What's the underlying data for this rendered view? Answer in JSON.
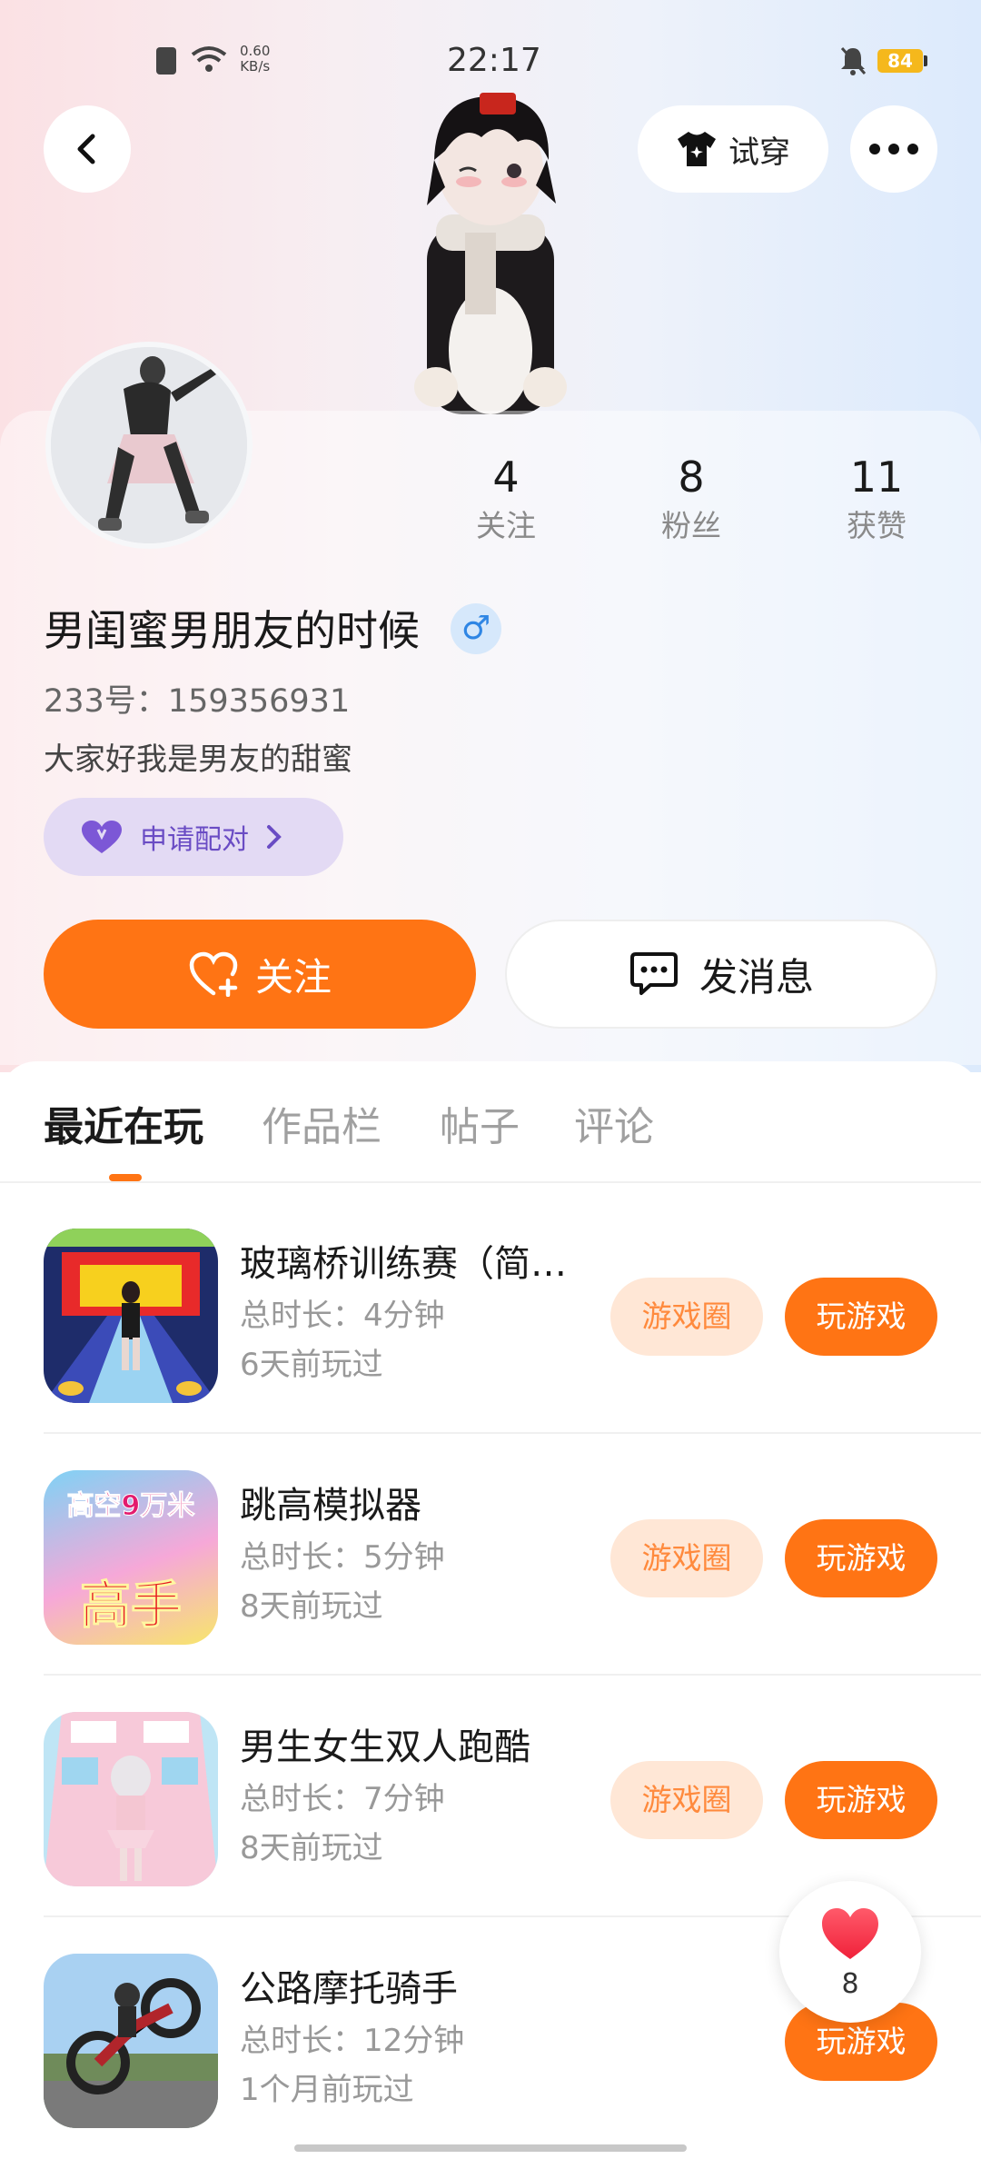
{
  "status_bar": {
    "time": "22:17",
    "net_speed_value": "0.60",
    "net_speed_unit": "KB/s",
    "battery": "84"
  },
  "header": {
    "tryon_label": "试穿"
  },
  "profile": {
    "stats": [
      {
        "value": "4",
        "label": "关注"
      },
      {
        "value": "8",
        "label": "粉丝"
      },
      {
        "value": "11",
        "label": "获赞"
      }
    ],
    "nickname": "男闺蜜男朋友的时候",
    "gender_symbol": "♂",
    "uid": "233号：159356931",
    "bio": "大家好我是男友的甜蜜",
    "pair_label": "申请配对",
    "follow_label": "关注",
    "message_label": "发消息"
  },
  "tabs": [
    {
      "label": "最近在玩",
      "active": true
    },
    {
      "label": "作品栏",
      "active": false
    },
    {
      "label": "帖子",
      "active": false
    },
    {
      "label": "评论",
      "active": false
    }
  ],
  "games": [
    {
      "title": "玻璃桥训练赛（简…",
      "duration": "总时长：4分钟",
      "last_played": "6天前玩过",
      "circle_label": "游戏圈",
      "play_label": "玩游戏",
      "icon_text": ""
    },
    {
      "title": "跳高模拟器",
      "duration": "总时长：5分钟",
      "last_played": "8天前玩过",
      "circle_label": "游戏圈",
      "play_label": "玩游戏",
      "icon_text_top": "高空9万米",
      "icon_text_bottom": "高手"
    },
    {
      "title": "男生女生双人跑酷",
      "duration": "总时长：7分钟",
      "last_played": "8天前玩过",
      "circle_label": "游戏圈",
      "play_label": "玩游戏"
    },
    {
      "title": "公路摩托骑手",
      "duration": "总时长：12分钟",
      "last_played": "1个月前玩过",
      "play_label": "玩游戏"
    }
  ],
  "like_float": {
    "count": "8"
  },
  "colors": {
    "accent": "#ff7414",
    "accent_light": "#ffe7d6",
    "pair_bg": "#e3daf4",
    "pair_text": "#6a4cc4"
  }
}
